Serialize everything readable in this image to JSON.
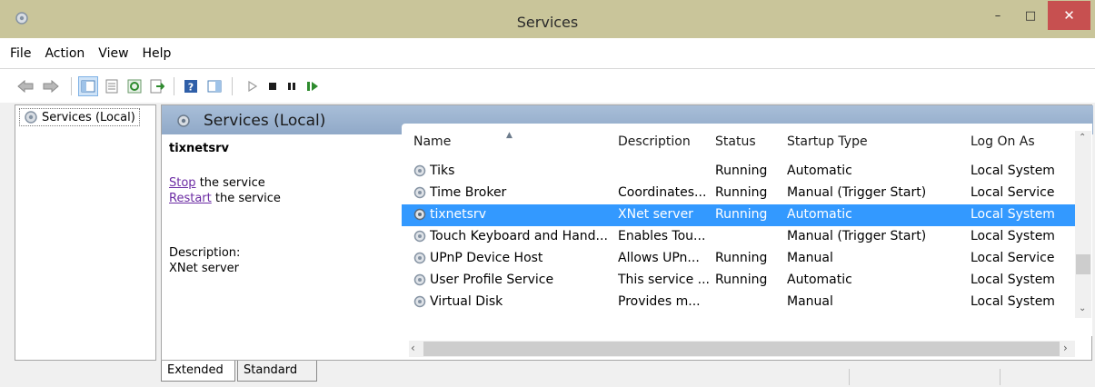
{
  "window": {
    "title": "Services",
    "controls": {
      "minimize": "–",
      "maximize": "□",
      "close": "✕"
    }
  },
  "menu": [
    "File",
    "Action",
    "View",
    "Help"
  ],
  "tree": {
    "root_label": "Services (Local)"
  },
  "panel": {
    "header_title": "Services (Local)",
    "selected_service": "tixnetsrv",
    "stop_link": "Stop",
    "stop_suffix": " the service",
    "restart_link": "Restart",
    "restart_suffix": " the service",
    "description_label": "Description:",
    "description_text": "XNet server"
  },
  "table": {
    "columns": [
      "Name",
      "Description",
      "Status",
      "Startup Type",
      "Log On As"
    ],
    "rows": [
      {
        "name": "Tiks",
        "description": "",
        "status": "Running",
        "startup": "Automatic",
        "logon": "Local System"
      },
      {
        "name": "Time Broker",
        "description": "Coordinates...",
        "status": "Running",
        "startup": "Manual (Trigger Start)",
        "logon": "Local Service"
      },
      {
        "name": "tixnetsrv",
        "description": "XNet server",
        "status": "Running",
        "startup": "Automatic",
        "logon": "Local System",
        "selected": true
      },
      {
        "name": "Touch Keyboard and Hand...",
        "description": "Enables Tou...",
        "status": "",
        "startup": "Manual (Trigger Start)",
        "logon": "Local System"
      },
      {
        "name": "UPnP Device Host",
        "description": "Allows UPn...",
        "status": "Running",
        "startup": "Manual",
        "logon": "Local Service"
      },
      {
        "name": "User Profile Service",
        "description": "This service ...",
        "status": "Running",
        "startup": "Automatic",
        "logon": "Local System"
      },
      {
        "name": "Virtual Disk",
        "description": "Provides m...",
        "status": "",
        "startup": "Manual",
        "logon": "Local System"
      }
    ]
  },
  "tabs": [
    "Extended",
    "Standard"
  ],
  "colors": {
    "titlebar": "#c9c59a",
    "close_button": "#c75050",
    "selection": "#3399ff",
    "header_band": "#a0b7d2",
    "link": "#6b2ba3"
  },
  "icons": [
    "services-gear-icon",
    "back-arrow-icon",
    "forward-arrow-icon",
    "show-hide-console-tree-icon",
    "properties-icon",
    "refresh-icon",
    "export-list-icon",
    "help-icon",
    "extended-view-icon",
    "start-service-icon",
    "stop-service-icon",
    "pause-service-icon",
    "resume-service-icon"
  ]
}
